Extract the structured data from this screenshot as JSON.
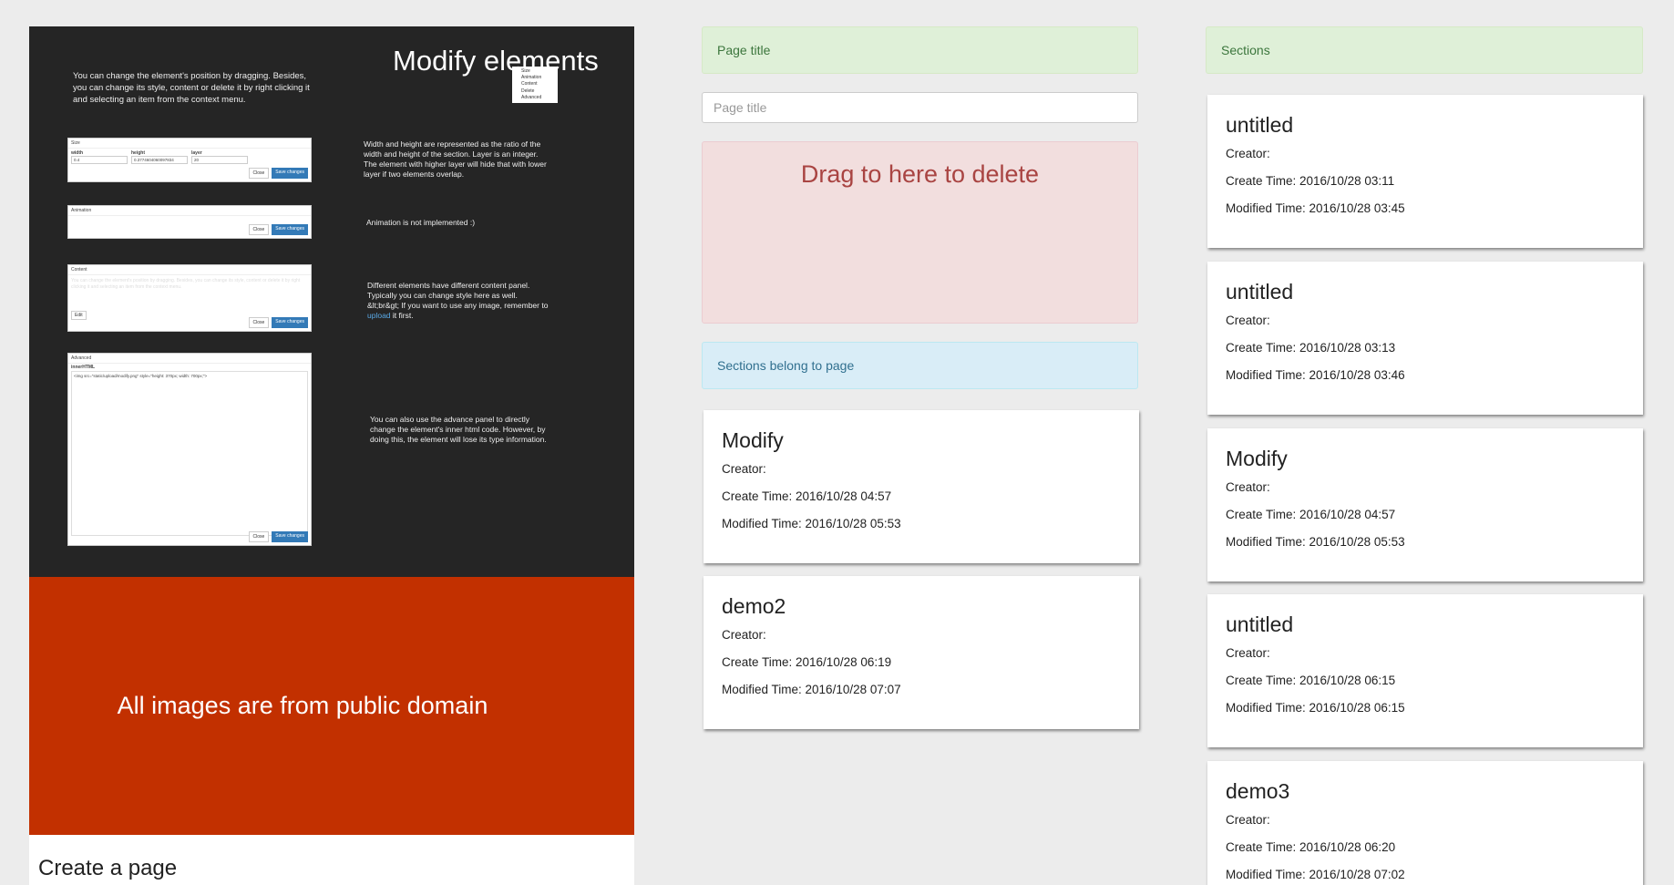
{
  "preview": {
    "modify_title": "Modify elements",
    "intro": "You can change the element's position by dragging. Besides, you can change its style, content or delete it by right clicking it and selecting an item from the context menu.",
    "context_menu": [
      "Size",
      "Animation",
      "Content",
      "Delete",
      "Advanced"
    ],
    "size_panel": {
      "title": "Size",
      "fields": [
        {
          "label": "width",
          "value": "0.4"
        },
        {
          "label": "height",
          "value": "0.3774604060097834"
        },
        {
          "label": "layer",
          "value": "20"
        }
      ],
      "close": "Close",
      "save": "Save changes"
    },
    "size_desc": "Width and height are represented as the ratio of the width and height of the section. Layer is an integer. The element with higher layer will hide that with lower layer if two elements overlap.",
    "animation_panel": {
      "title": "Animation",
      "close": "Close",
      "save": "Save changes"
    },
    "animation_desc": "Animation is not implemented :)",
    "content_panel": {
      "title": "Content",
      "text": "You can change the element's position by dragging. Besides, you can change its style, content or delete it by right clicking it and selecting an item from the context menu.",
      "edit": "Edit",
      "close": "Close",
      "save": "Save changes"
    },
    "content_desc_before": "Different elements have different content panel. Typically you can change style here as well. &lt;br&gt; If you want to use any image, remember to ",
    "content_desc_link": "upload",
    "content_desc_after": " it first.",
    "advanced_panel": {
      "title": "Advanced",
      "label": "innerHTML",
      "code": "<img src=\"static/upload/modify.png\" style=\"height: 370px; width: 700px;\">",
      "close": "Close",
      "save": "Save changes"
    },
    "advanced_desc": "You can also use the advance panel to directly change the element's inner html code. However, by doing this, the element will lose its type information.",
    "red_text": "All images are from public domain",
    "create_page": "Create a page"
  },
  "middle": {
    "page_title_label": "Page title",
    "page_title_placeholder": "Page title",
    "delete_zone": "Drag to here to delete",
    "sections_belong_label": "Sections belong to page",
    "cards": [
      {
        "title": "Modify",
        "creator": "Creator:",
        "create_time": "Create Time: 2016/10/28 04:57",
        "modified_time": "Modified Time: 2016/10/28 05:53"
      },
      {
        "title": "demo2",
        "creator": "Creator:",
        "create_time": "Create Time: 2016/10/28 06:19",
        "modified_time": "Modified Time: 2016/10/28 07:07"
      }
    ]
  },
  "right": {
    "sections_label": "Sections",
    "cards": [
      {
        "title": "untitled",
        "creator": "Creator:",
        "create_time": "Create Time: 2016/10/28 03:11",
        "modified_time": "Modified Time: 2016/10/28 03:45"
      },
      {
        "title": "untitled",
        "creator": "Creator:",
        "create_time": "Create Time: 2016/10/28 03:13",
        "modified_time": "Modified Time: 2016/10/28 03:46"
      },
      {
        "title": "Modify",
        "creator": "Creator:",
        "create_time": "Create Time: 2016/10/28 04:57",
        "modified_time": "Modified Time: 2016/10/28 05:53"
      },
      {
        "title": "untitled",
        "creator": "Creator:",
        "create_time": "Create Time: 2016/10/28 06:15",
        "modified_time": "Modified Time: 2016/10/28 06:15"
      },
      {
        "title": "demo3",
        "creator": "Creator:",
        "create_time": "Create Time: 2016/10/28 06:20",
        "modified_time": "Modified Time: 2016/10/28 07:02"
      }
    ]
  },
  "colors": {
    "dark_section": "#252525",
    "red_section": "#c23000",
    "success_bg": "#dff0d8",
    "info_bg": "#d9edf7",
    "danger_bg": "#f2dede",
    "primary_button": "#337ab7"
  }
}
